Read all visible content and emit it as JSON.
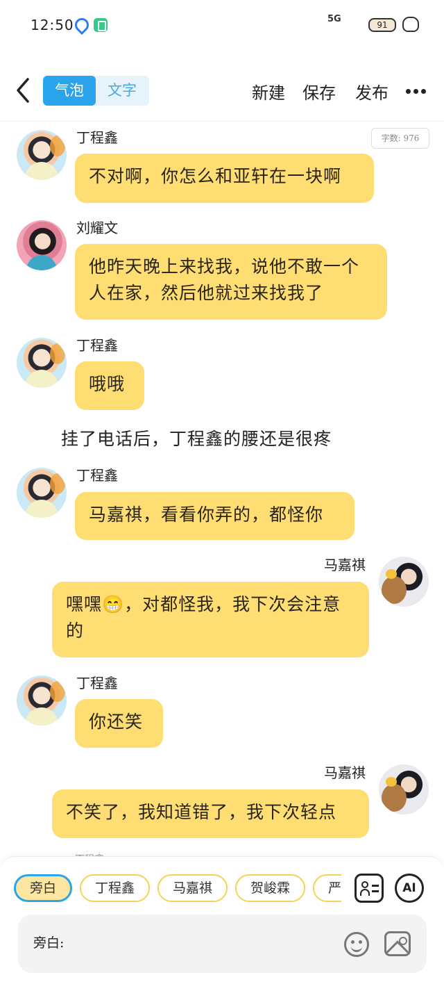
{
  "status_bar": {
    "time": "12:50",
    "network": "5G",
    "battery": "91"
  },
  "header": {
    "tab_bubble": "气泡",
    "tab_text": "文字",
    "new_label": "新建",
    "save_label": "保存",
    "publish_label": "发布"
  },
  "word_count": "字数: 976",
  "messages": [
    {
      "name": "丁程鑫",
      "text": "不对啊，你怎么和亚轩在一块啊"
    },
    {
      "name": "刘耀文",
      "text": "他昨天晚上来找我，说他不敢一个人在家，然后他就过来找我了"
    },
    {
      "name": "丁程鑫",
      "text": "哦哦"
    },
    {
      "narration": "挂了电话后，丁程鑫的腰还是很疼"
    },
    {
      "name": "丁程鑫",
      "text": "马嘉祺，看看你弄的，都怪你"
    },
    {
      "name": "马嘉祺",
      "text": "嘿嘿😁，对都怪我，我下次会注意的"
    },
    {
      "name": "丁程鑫",
      "text": "你还笑"
    },
    {
      "name": "马嘉祺",
      "text": "不笑了，我知道错了，我下次轻点"
    }
  ],
  "partial_name": "丁程鑫",
  "speakers": [
    "旁白",
    "丁程鑫",
    "马嘉祺",
    "贺峻霖",
    "严浩翔"
  ],
  "ai_label": "AI",
  "input": {
    "label": "旁白:",
    "value": ""
  }
}
